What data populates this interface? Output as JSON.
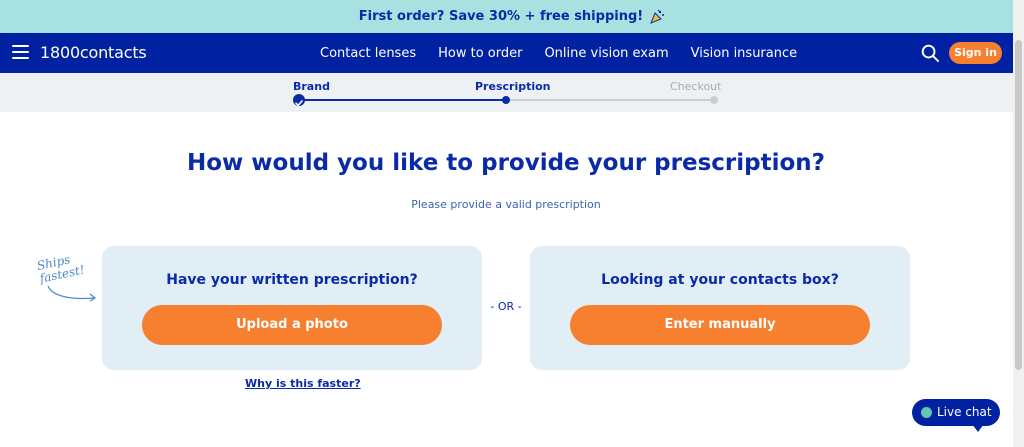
{
  "promo": {
    "text": "First order? Save 30% + free shipping!",
    "icon": "party-popper-icon"
  },
  "nav": {
    "logo": "1800contacts",
    "links": [
      "Contact lenses",
      "How to order",
      "Online vision exam",
      "Vision insurance"
    ],
    "sign_in": "Sign in"
  },
  "steps": [
    {
      "label": "Brand",
      "state": "done"
    },
    {
      "label": "Prescription",
      "state": "current"
    },
    {
      "label": "Checkout",
      "state": "upcoming"
    }
  ],
  "main": {
    "heading": "How would you like to provide your prescription?",
    "subheading": "Please provide a valid prescription",
    "annotation": "Ships fastest!",
    "or_label": "- OR -",
    "cards": [
      {
        "title": "Have your written prescription?",
        "button": "Upload a photo"
      },
      {
        "title": "Looking at your contacts box?",
        "button": "Enter manually"
      }
    ],
    "why_link": "Why is this faster?"
  },
  "live_chat": "Live chat",
  "colors": {
    "brand_blue": "#0022a2",
    "accent_orange": "#f77f30",
    "promo_bg": "#a7e1e0",
    "card_bg": "#e1eef5"
  }
}
